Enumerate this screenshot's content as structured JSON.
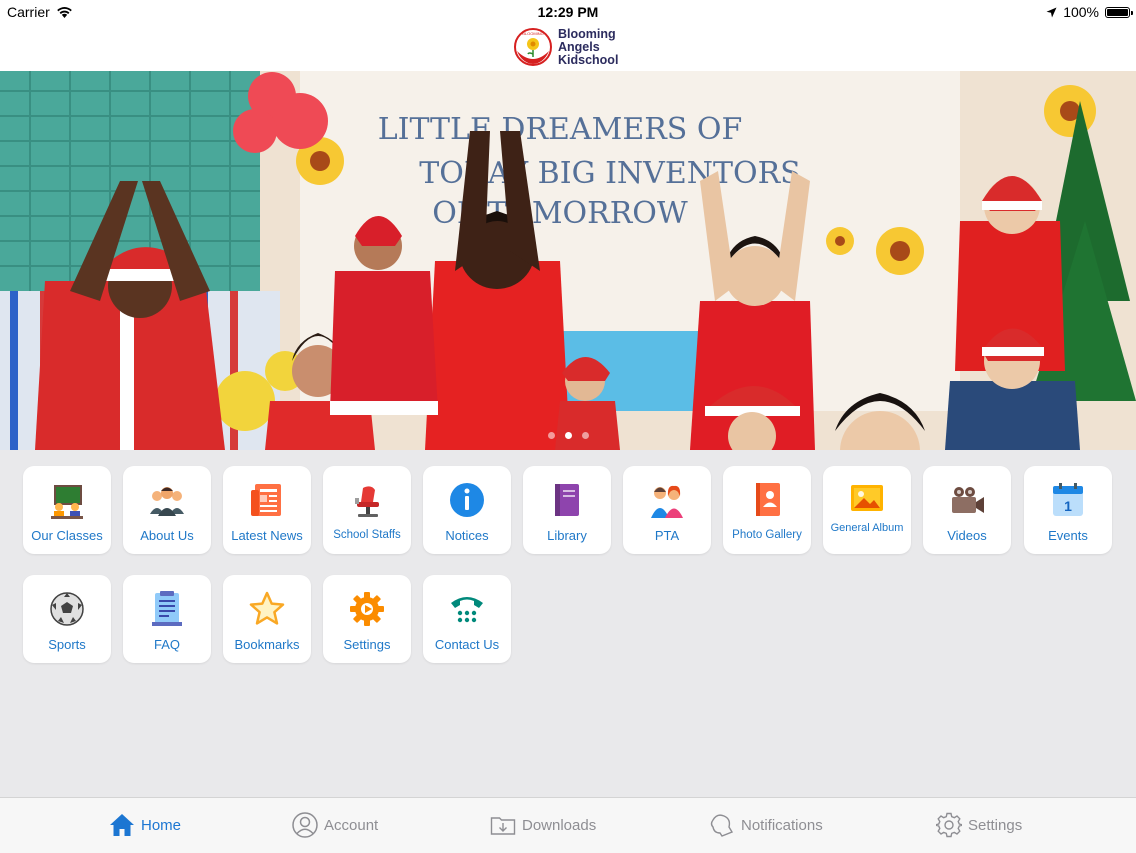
{
  "status_bar": {
    "carrier": "Carrier",
    "time": "12:29 PM",
    "battery": "100%"
  },
  "header": {
    "logo_line1": "Blooming",
    "logo_line2": "Angels",
    "logo_line3": "Kidschool",
    "logo_seal_text": "Blooming Angels Kidschool"
  },
  "banner": {
    "slide_count": 3,
    "active_slide": 2,
    "poster_text": "THEME · LITTLE DREAMERS OF TODAY, BIG INVENTORS OF TOMORROW"
  },
  "menu": {
    "row1": [
      {
        "label": "Our Classes",
        "icon": "classroom-icon"
      },
      {
        "label": "About Us",
        "icon": "people-icon"
      },
      {
        "label": "Latest News",
        "icon": "newspaper-icon"
      },
      {
        "label": "School Staffs",
        "icon": "barber-chair-icon"
      },
      {
        "label": "Notices",
        "icon": "info-icon"
      },
      {
        "label": "Library",
        "icon": "book-icon"
      },
      {
        "label": "PTA",
        "icon": "parents-icon"
      },
      {
        "label": "Photo Gallery",
        "icon": "contact-book-icon"
      },
      {
        "label": "General Album",
        "icon": "image-icon"
      },
      {
        "label": "Videos",
        "icon": "video-camera-icon"
      },
      {
        "label": "Events",
        "icon": "calendar-icon",
        "badge": "1"
      }
    ],
    "row2": [
      {
        "label": "Sports",
        "icon": "soccer-ball-icon"
      },
      {
        "label": "FAQ",
        "icon": "document-icon"
      },
      {
        "label": "Bookmarks",
        "icon": "star-icon"
      },
      {
        "label": "Settings",
        "icon": "gear-icon"
      },
      {
        "label": "Contact Us",
        "icon": "telephone-icon"
      }
    ]
  },
  "tabbar": {
    "home": "Home",
    "account": "Account",
    "downloads": "Downloads",
    "notifications": "Notifications",
    "settings": "Settings"
  },
  "colors": {
    "accent": "#1c76d2",
    "tile_label": "#1f78c8",
    "background": "#e9e9eb"
  }
}
